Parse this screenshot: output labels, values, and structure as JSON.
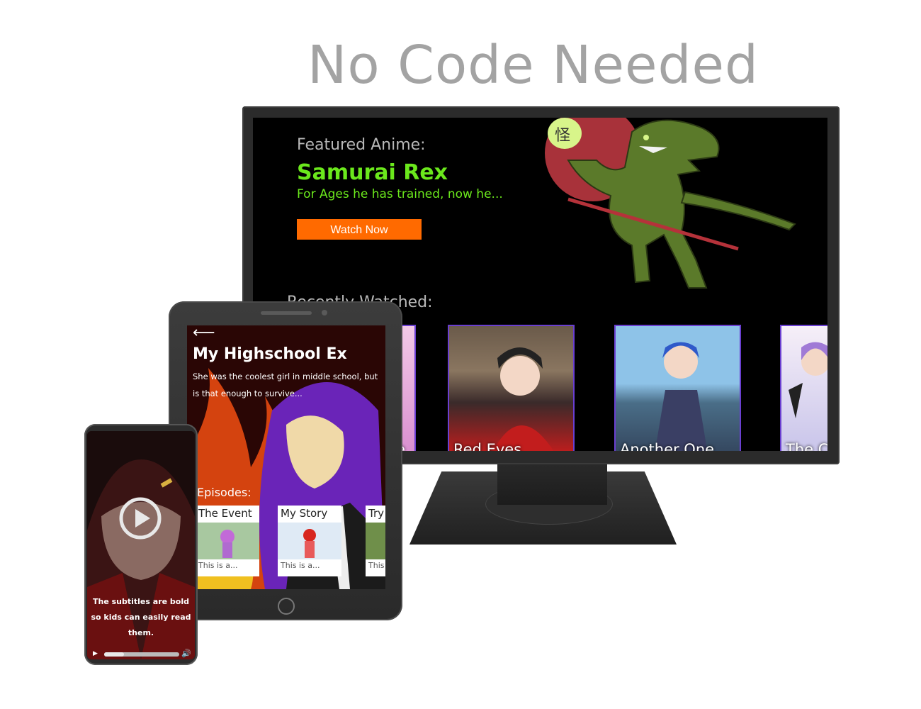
{
  "headline": "No Code Needed",
  "monitor": {
    "featured_label": "Featured Anime:",
    "featured_title": "Samurai Rex",
    "featured_description": "For Ages he has trained, now he...",
    "watch_button": "Watch Now",
    "recent_label": "Recently Watched:",
    "recent_items": [
      "e",
      "Red Eyes",
      "Another One",
      "The C"
    ]
  },
  "tablet": {
    "back_icon": "back-arrow-icon",
    "title": "My Highschool Ex",
    "description": "She was the coolest girl in middle school, but is that enough to survive...",
    "episodes_label": "Episodes:",
    "episodes": [
      {
        "title": "The Event",
        "description": "This is a..."
      },
      {
        "title": "My Story",
        "description": "This is a..."
      },
      {
        "title": "Try",
        "description": "This"
      }
    ]
  },
  "phone": {
    "subtitle": "The subtitles are bold so kids can easily read them.",
    "progress": 0.25,
    "icons": [
      "play-icon",
      "volume-icon"
    ]
  },
  "colors": {
    "accent_green": "#6be81c",
    "button_orange": "#ff6a00",
    "headline_gray": "#a3a3a3",
    "poster_border": "#6a3fd0"
  }
}
